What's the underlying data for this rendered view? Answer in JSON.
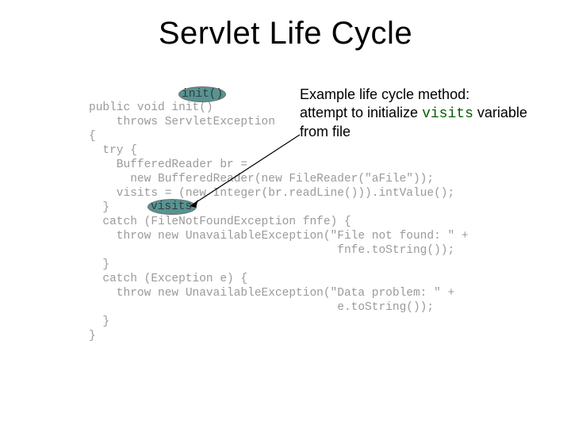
{
  "title": "Servlet Life Cycle",
  "callout": {
    "line1": "Example life cycle method:",
    "line2a": "attempt to initialize ",
    "line2_code": "visits",
    "line2b": " variable",
    "line3": "from file"
  },
  "code_hl": {
    "init": "init()",
    "visits": "visits"
  },
  "code": "public void init()\n    throws ServletException\n{\n  try {\n    BufferedReader br =\n      new BufferedReader(new FileReader(\"aFile\"));\n    visits = (new Integer(br.readLine())).intValue();\n  }\n  catch (FileNotFoundException fnfe) {\n    throw new UnavailableException(\"File not found: \" +\n                                    fnfe.toString());\n  }\n  catch (Exception e) {\n    throw new UnavailableException(\"Data problem: \" +\n                                    e.toString());\n  }\n}"
}
